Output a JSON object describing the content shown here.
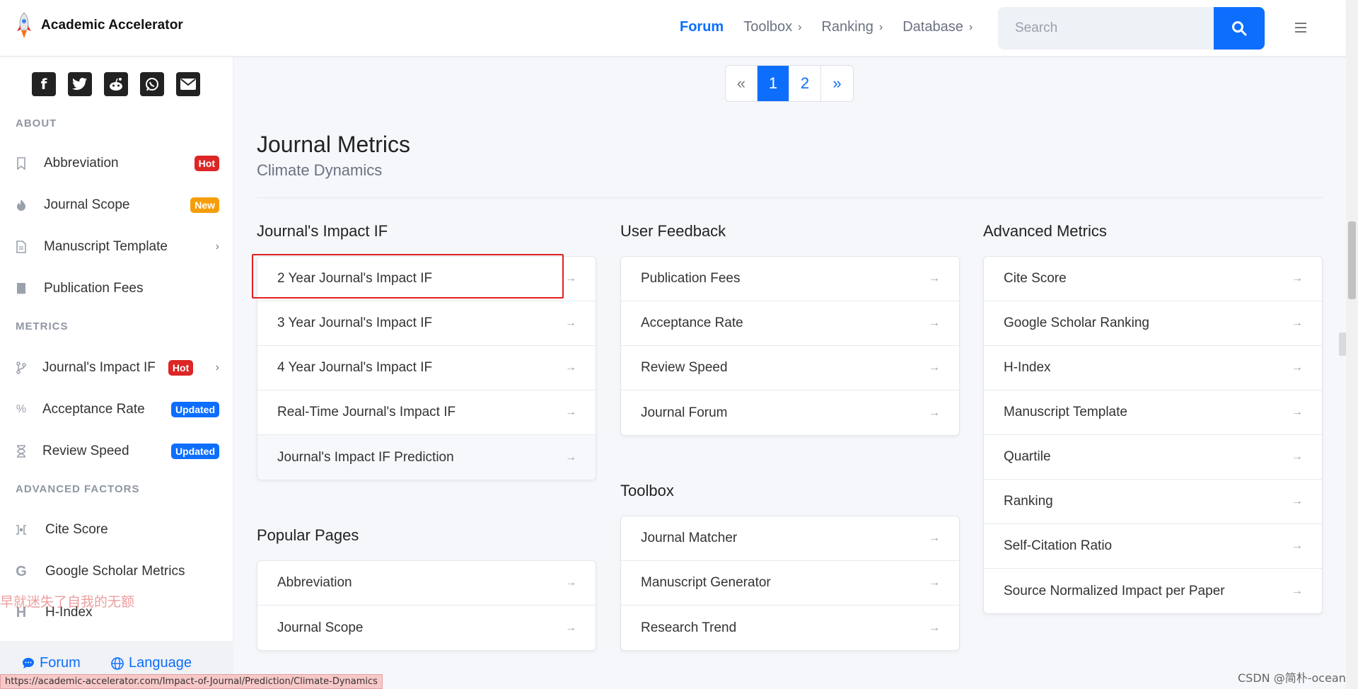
{
  "header": {
    "brand": "Academic Accelerator",
    "nav": [
      {
        "label": "Forum",
        "active": true,
        "dropdown": false
      },
      {
        "label": "Toolbox",
        "active": false,
        "dropdown": true
      },
      {
        "label": "Ranking",
        "active": false,
        "dropdown": true
      },
      {
        "label": "Database",
        "active": false,
        "dropdown": true
      }
    ],
    "search_placeholder": "Search",
    "accent": "#0d6efd"
  },
  "sidebar": {
    "social": [
      "facebook-icon",
      "twitter-icon",
      "reddit-icon",
      "whatsapp-icon",
      "email-icon"
    ],
    "sections": [
      {
        "heading": "ABOUT",
        "items": [
          {
            "label": "Abbreviation",
            "icon": "bookmark-icon",
            "badge": "Hot",
            "badge_type": "hot",
            "chevron": false
          },
          {
            "label": "Journal Scope",
            "icon": "flame-icon",
            "badge": "New",
            "badge_type": "new",
            "chevron": false
          },
          {
            "label": "Manuscript Template",
            "icon": "document-icon",
            "badge": "",
            "badge_type": "",
            "chevron": true
          },
          {
            "label": "Publication Fees",
            "icon": "receipt-icon",
            "badge": "",
            "badge_type": "",
            "chevron": false
          }
        ]
      },
      {
        "heading": "METRICS",
        "items": [
          {
            "label": "Journal's Impact IF",
            "icon": "branch-icon",
            "badge": "Hot",
            "badge_type": "hot",
            "chevron": true
          },
          {
            "label": "Acceptance Rate",
            "icon": "percent-icon",
            "badge": "Updated",
            "badge_type": "updated",
            "chevron": false
          },
          {
            "label": "Review Speed",
            "icon": "hourglass-icon",
            "badge": "Updated",
            "badge_type": "updated",
            "chevron": false
          }
        ]
      },
      {
        "heading": "ADVANCED FACTORS",
        "items": [
          {
            "label": "Cite Score",
            "icon": "quote-icon",
            "badge": "",
            "badge_type": "",
            "chevron": false
          },
          {
            "label": "Google Scholar Metrics",
            "icon": "google-icon",
            "badge": "",
            "badge_type": "",
            "chevron": false
          },
          {
            "label": "H-Index",
            "icon": "h-icon",
            "badge": "",
            "badge_type": "",
            "chevron": false
          }
        ]
      }
    ],
    "bottom": {
      "forum": "Forum",
      "language": "Language"
    }
  },
  "pagination": {
    "prev": "«",
    "pages": [
      "1",
      "2"
    ],
    "current": "1",
    "next": "»"
  },
  "main": {
    "title": "Journal Metrics",
    "subtitle": "Climate Dynamics",
    "columns": {
      "impact": {
        "heading": "Journal's Impact IF",
        "items": [
          "2 Year Journal's Impact IF",
          "3 Year Journal's Impact IF",
          "4 Year Journal's Impact IF",
          "Real-Time Journal's Impact IF",
          "Journal's Impact IF Prediction"
        ]
      },
      "popular": {
        "heading": "Popular Pages",
        "items": [
          "Abbreviation",
          "Journal Scope"
        ]
      },
      "feedback": {
        "heading": "User Feedback",
        "items": [
          "Publication Fees",
          "Acceptance Rate",
          "Review Speed",
          "Journal Forum"
        ]
      },
      "toolbox": {
        "heading": "Toolbox",
        "items": [
          "Journal Matcher",
          "Manuscript Generator",
          "Research Trend"
        ]
      },
      "advanced": {
        "heading": "Advanced Metrics",
        "items": [
          "Cite Score",
          "Google Scholar Ranking",
          "H-Index",
          "Manuscript Template",
          "Quartile",
          "Ranking",
          "Self-Citation Ratio",
          "Source Normalized Impact per Paper"
        ]
      }
    }
  },
  "overlay_text": "早就迷失了自我的无额",
  "status_url": "https://academic-accelerator.com/Impact-of-Journal/Prediction/Climate-Dynamics",
  "watermark": "CSDN @简朴-ocean"
}
